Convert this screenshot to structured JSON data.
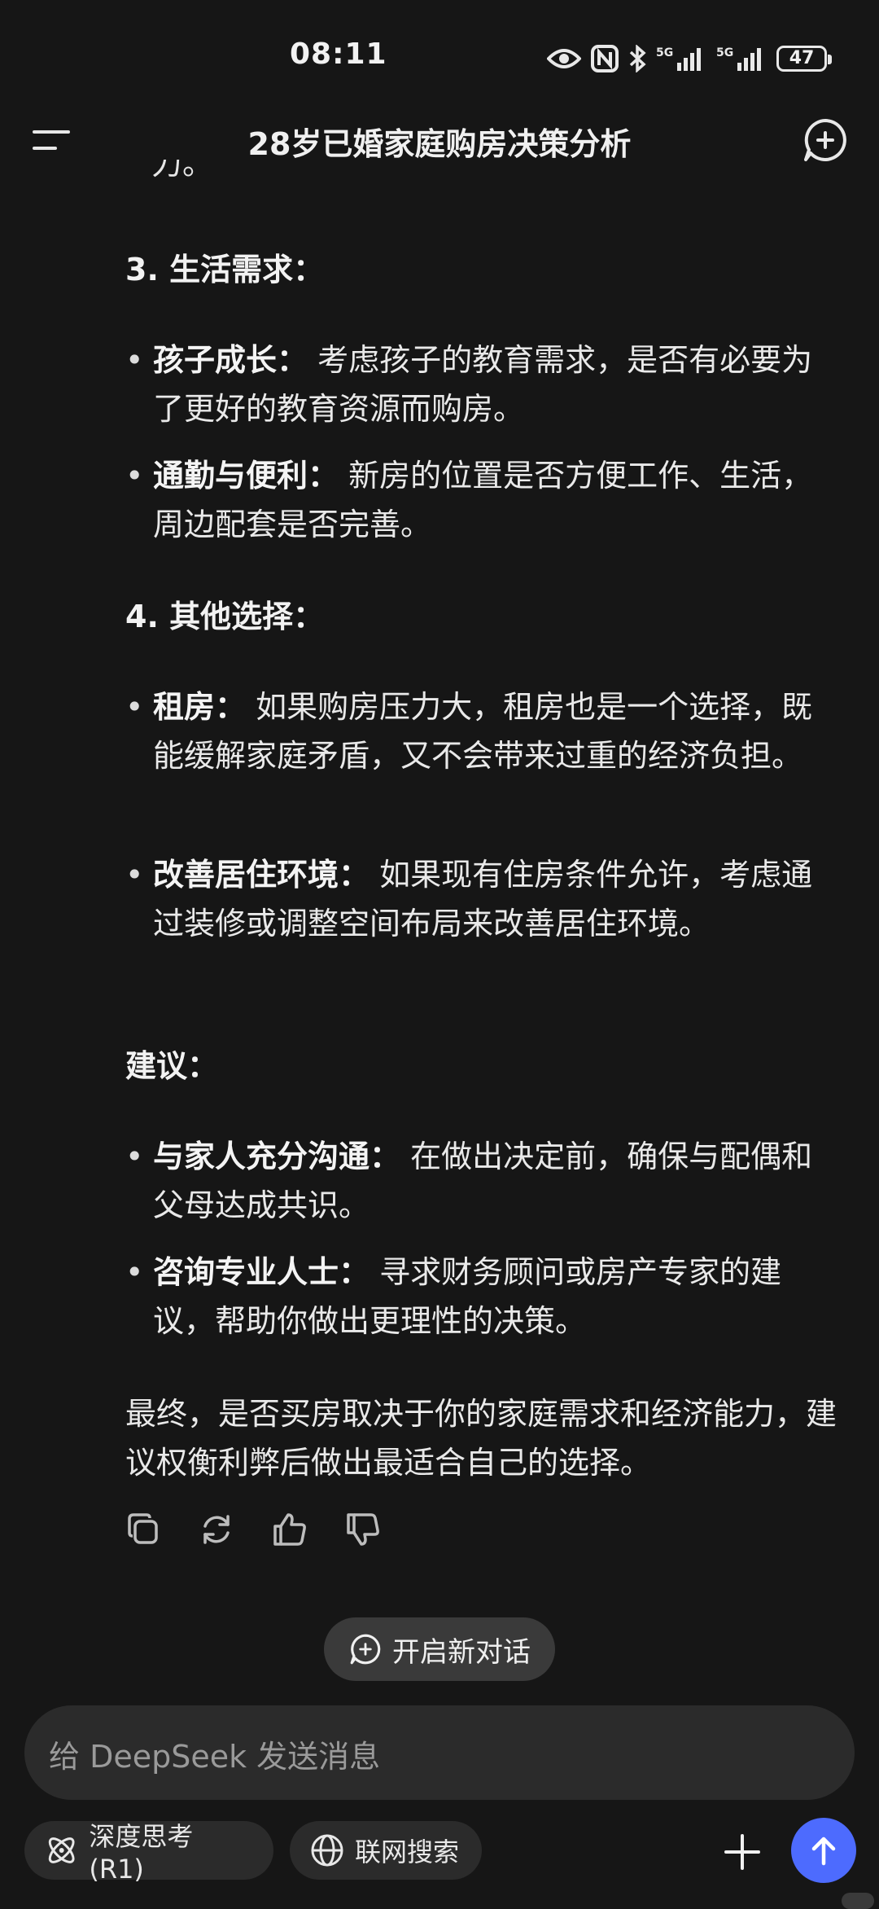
{
  "status": {
    "time": "08:11",
    "battery": "47",
    "network1": "5G",
    "network2": "5G"
  },
  "header": {
    "title": "28岁已婚家庭购房决策分析"
  },
  "content": {
    "cut_text": "力。",
    "sec3_title": "3. 生活需求：",
    "sec3_items": [
      {
        "label": "孩子成长：",
        "text": "考虑孩子的教育需求，是否有必要为了更好的教育资源而购房。"
      },
      {
        "label": "通勤与便利：",
        "text": "新房的位置是否方便工作、生活，周边配套是否完善。"
      }
    ],
    "sec4_title": "4. 其他选择：",
    "sec4_items": [
      {
        "label": "租房：",
        "text": "如果购房压力大，租房也是一个选择，既能缓解家庭矛盾，又不会带来过重的经济负担。"
      },
      {
        "label": "改善居住环境：",
        "text": "如果现有住房条件允许，考虑通过装修或调整空间布局来改善居住环境。"
      }
    ],
    "advice_title": "建议：",
    "advice_items": [
      {
        "label": "与家人充分沟通：",
        "text": "在做出决定前，确保与配偶和父母达成共识。"
      },
      {
        "label": "咨询专业人士：",
        "text": "寻求财务顾问或房产专家的建议，帮助你做出更理性的决策。"
      }
    ],
    "final": "最终，是否买房取决于你的家庭需求和经济能力，建议权衡利弊后做出最适合自己的选择。"
  },
  "icons": {
    "copy": "copy-icon",
    "regenerate": "refresh-icon",
    "like": "thumbs-up-icon",
    "dislike": "thumbs-down-icon"
  },
  "new_chat_label": "开启新对话",
  "input": {
    "placeholder": "给 DeepSeek 发送消息"
  },
  "chips": {
    "deep_think": "深度思考 (R1)",
    "web_search": "联网搜索"
  },
  "colors": {
    "background": "#161616",
    "accent": "#4d6bfe",
    "surface": "#2b2b2b"
  }
}
